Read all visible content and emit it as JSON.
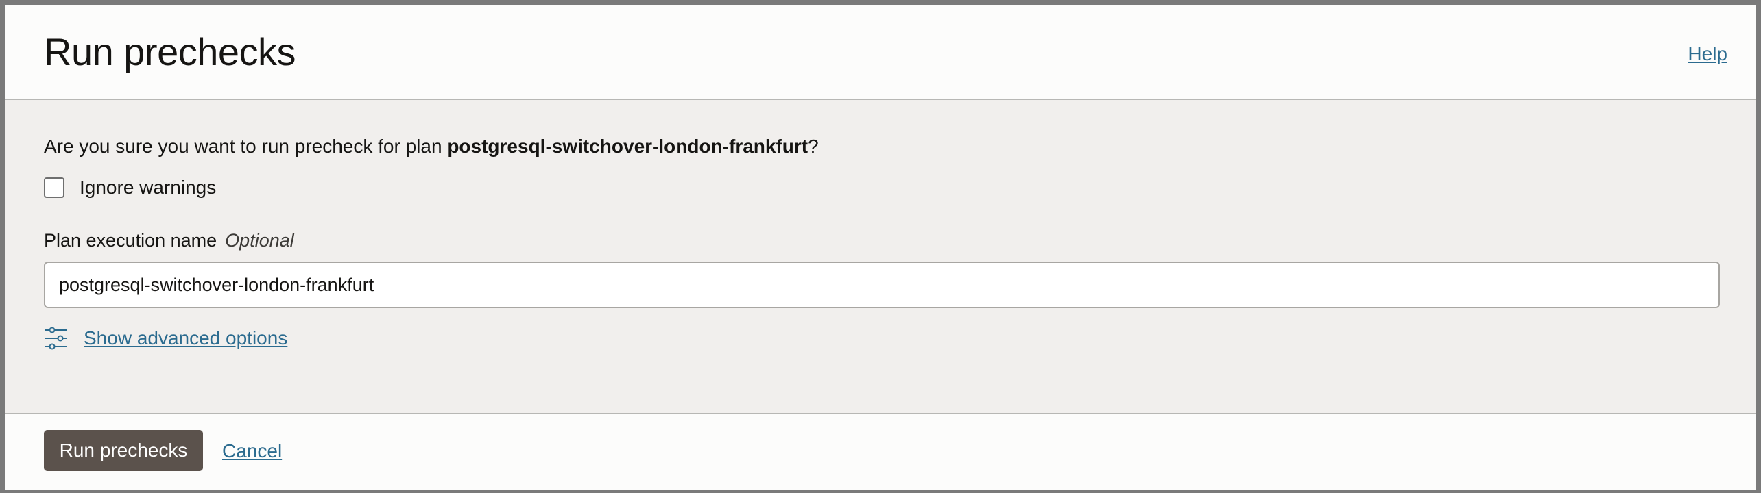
{
  "dialog": {
    "title": "Run prechecks",
    "help_label": "Help"
  },
  "body": {
    "question_prefix": "Are you sure you want to run precheck for plan ",
    "plan_name": "postgresql-switchover-london-frankfurt",
    "question_suffix": "?",
    "ignore_warnings": {
      "label": "Ignore warnings",
      "checked": false
    },
    "execution_name": {
      "label": "Plan execution name",
      "optional_label": "Optional",
      "value": "postgresql-switchover-london-frankfurt"
    },
    "advanced_options_label": "Show advanced options",
    "advanced_options_icon": "sliders-icon"
  },
  "footer": {
    "run_button_label": "Run prechecks",
    "cancel_label": "Cancel"
  },
  "colors": {
    "primary_button": "#5b524c",
    "link": "#2b6b8f",
    "body_background": "#f1efed"
  }
}
